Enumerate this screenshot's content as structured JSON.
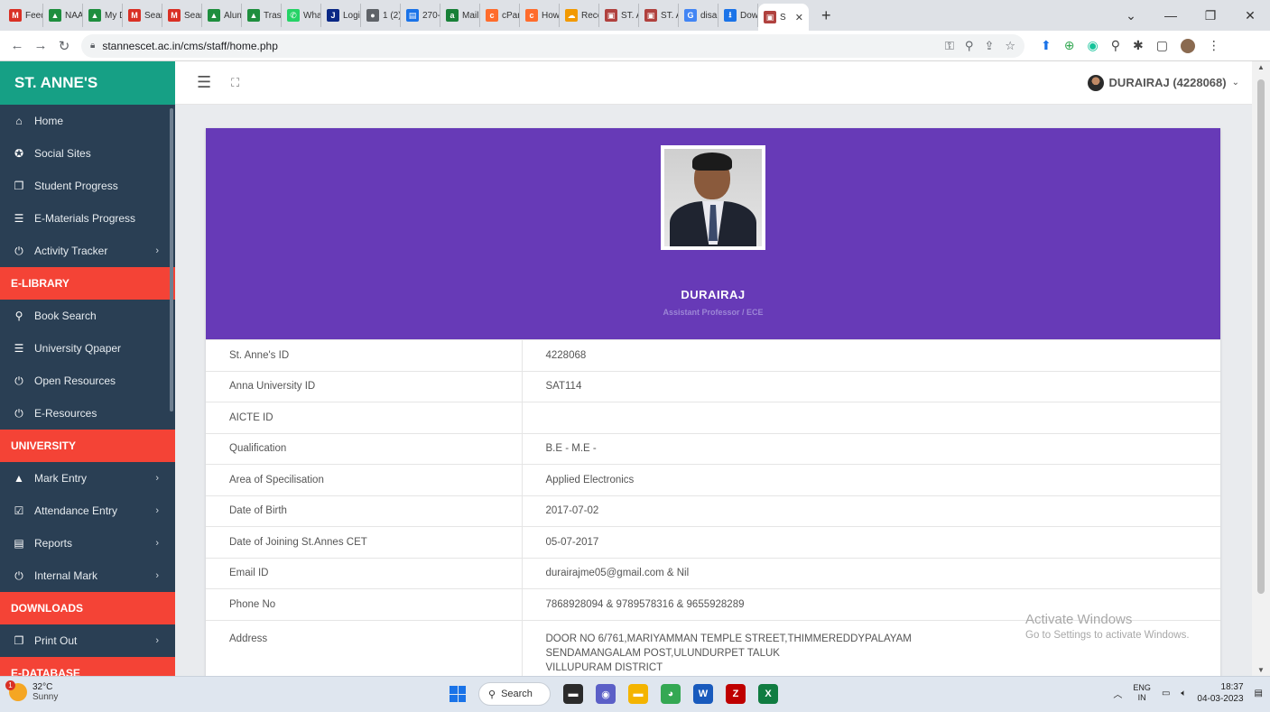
{
  "browser": {
    "tabs": [
      {
        "label": "Feed",
        "icon": "gmail-icon",
        "color": "#d93025",
        "glyph": "M"
      },
      {
        "label": "NAAC",
        "icon": "drive-icon",
        "color": "#1e8e3e",
        "glyph": "▲"
      },
      {
        "label": "My D",
        "icon": "drive-icon",
        "color": "#1e8e3e",
        "glyph": "▲"
      },
      {
        "label": "Searc",
        "icon": "gmail-icon",
        "color": "#d93025",
        "glyph": "M"
      },
      {
        "label": "Searc",
        "icon": "gmail-icon",
        "color": "#d93025",
        "glyph": "M"
      },
      {
        "label": "Alum",
        "icon": "drive-icon",
        "color": "#1e8e3e",
        "glyph": "▲"
      },
      {
        "label": "Trash",
        "icon": "drive-icon",
        "color": "#1e8e3e",
        "glyph": "▲"
      },
      {
        "label": "What",
        "icon": "whatsapp-icon",
        "color": "#25d366",
        "glyph": "✆"
      },
      {
        "label": "Login",
        "icon": "jio-icon",
        "color": "#0a2885",
        "glyph": "J"
      },
      {
        "label": "1 (2)",
        "icon": "generic-icon",
        "color": "#5f6368",
        "glyph": "●"
      },
      {
        "label": "270-",
        "icon": "sheet-icon",
        "color": "#1a73e8",
        "glyph": "▤"
      },
      {
        "label": "Mail",
        "icon": "mail-icon",
        "color": "#188038",
        "glyph": "a"
      },
      {
        "label": "cPan",
        "icon": "cpanel-icon",
        "color": "#ff6c2c",
        "glyph": "c"
      },
      {
        "label": "How",
        "icon": "cpanel-icon",
        "color": "#ff6c2c",
        "glyph": "c"
      },
      {
        "label": "Reco",
        "icon": "cloud-icon",
        "color": "#f29900",
        "glyph": "☁"
      },
      {
        "label": "ST. A",
        "icon": "college-icon",
        "color": "#b0413e",
        "glyph": "▣"
      },
      {
        "label": "ST. A",
        "icon": "college-icon",
        "color": "#b0413e",
        "glyph": "▣"
      },
      {
        "label": "disal",
        "icon": "google-icon",
        "color": "#4285f4",
        "glyph": "G"
      },
      {
        "label": "Dow",
        "icon": "download-icon",
        "color": "#1a73e8",
        "glyph": "⭳"
      }
    ],
    "active_tab": {
      "label": "S",
      "icon": "college-icon",
      "color": "#b0413e",
      "glyph": "▣"
    },
    "url": "stannescet.ac.in/cms/staff/home.php"
  },
  "sidebar": {
    "brand": "ST. ANNE'S",
    "groups": [
      {
        "section": "",
        "items": [
          {
            "label": "Home",
            "icon": "home-icon",
            "glyph": "⌂",
            "arrow": false
          },
          {
            "label": "Social Sites",
            "icon": "globe-icon",
            "glyph": "✪",
            "arrow": false
          },
          {
            "label": "Student Progress",
            "icon": "clone-icon",
            "glyph": "❐",
            "arrow": false
          },
          {
            "label": "E-Materials Progress",
            "icon": "database-icon",
            "glyph": "☰",
            "arrow": false
          },
          {
            "label": "Activity Tracker",
            "icon": "power-icon",
            "glyph": "⏻",
            "arrow": true
          }
        ]
      },
      {
        "section": "E-LIBRARY",
        "items": [
          {
            "label": "Book Search",
            "icon": "search-icon",
            "glyph": "⚲",
            "arrow": false
          },
          {
            "label": "University Qpaper",
            "icon": "database-icon",
            "glyph": "☰",
            "arrow": false
          },
          {
            "label": "Open Resources",
            "icon": "power-icon",
            "glyph": "⏻",
            "arrow": false
          },
          {
            "label": "E-Resources",
            "icon": "power-icon",
            "glyph": "⏻",
            "arrow": false
          }
        ]
      },
      {
        "section": "UNIVERSITY",
        "items": [
          {
            "label": "Mark Entry",
            "icon": "mountain-icon",
            "glyph": "▲",
            "arrow": true
          },
          {
            "label": "Attendance Entry",
            "icon": "calendar-check-icon",
            "glyph": "☑",
            "arrow": true
          },
          {
            "label": "Reports",
            "icon": "report-icon",
            "glyph": "▤",
            "arrow": true
          },
          {
            "label": "Internal Mark",
            "icon": "power-icon",
            "glyph": "⏻",
            "arrow": true
          }
        ]
      },
      {
        "section": "DOWNLOADS",
        "items": [
          {
            "label": "Print Out",
            "icon": "clone-icon",
            "glyph": "❐",
            "arrow": true
          }
        ]
      },
      {
        "section": "E-DATABASE",
        "items": []
      }
    ]
  },
  "header": {
    "user": "DURAIRAJ (4228068)"
  },
  "profile": {
    "name": "DURAIRAJ",
    "role": "Assistant Professor / ECE",
    "fields": [
      {
        "label": "St. Anne's ID",
        "value": "4228068"
      },
      {
        "label": "Anna University ID",
        "value": "SAT114"
      },
      {
        "label": "AICTE ID",
        "value": ""
      },
      {
        "label": "Qualification",
        "value": "B.E - M.E -"
      },
      {
        "label": "Area of Specilisation",
        "value": "Applied Electronics"
      },
      {
        "label": "Date of Birth",
        "value": "2017-07-02"
      },
      {
        "label": "Date of Joining St.Annes CET",
        "value": "05-07-2017"
      },
      {
        "label": "Email ID",
        "value": "durairajme05@gmail.com & Nil"
      },
      {
        "label": "Phone No",
        "value": "7868928094 & 9789578316 & 9655928289"
      }
    ],
    "address_label": "Address",
    "address_lines": [
      "DOOR NO 6/761,MARIYAMMAN TEMPLE STREET,THIMMEREDDYPALAYAM",
      "SENDAMANGALAM POST,ULUNDURPET TALUK",
      "VILLUPURAM DISTRICT"
    ]
  },
  "watermark": {
    "title": "Activate Windows",
    "subtitle": "Go to Settings to activate Windows."
  },
  "taskbar": {
    "weather_temp": "32°C",
    "weather_desc": "Sunny",
    "weather_badge": "1",
    "search_label": "Search",
    "lang_top": "ENG",
    "lang_bottom": "IN",
    "time": "18:37",
    "date": "04-03-2023",
    "apps": [
      {
        "icon": "file-explorer-icon",
        "color": "#2b2b2b",
        "glyph": "▬"
      },
      {
        "icon": "teams-chat-icon",
        "color": "#5b5fc7",
        "glyph": "◉"
      },
      {
        "icon": "folder-icon",
        "color": "#f4b400",
        "glyph": "▬"
      },
      {
        "icon": "chrome-icon",
        "color": "#34a853",
        "glyph": "◕"
      },
      {
        "icon": "word-icon",
        "color": "#185abd",
        "glyph": "W"
      },
      {
        "icon": "filezilla-icon",
        "color": "#bf0000",
        "glyph": "Z"
      },
      {
        "icon": "excel-icon",
        "color": "#107c41",
        "glyph": "X"
      }
    ]
  },
  "colors": {
    "brand": "#16a085",
    "sidebar": "#2a3f54",
    "section": "#f44336",
    "profile_header": "#673ab7"
  }
}
